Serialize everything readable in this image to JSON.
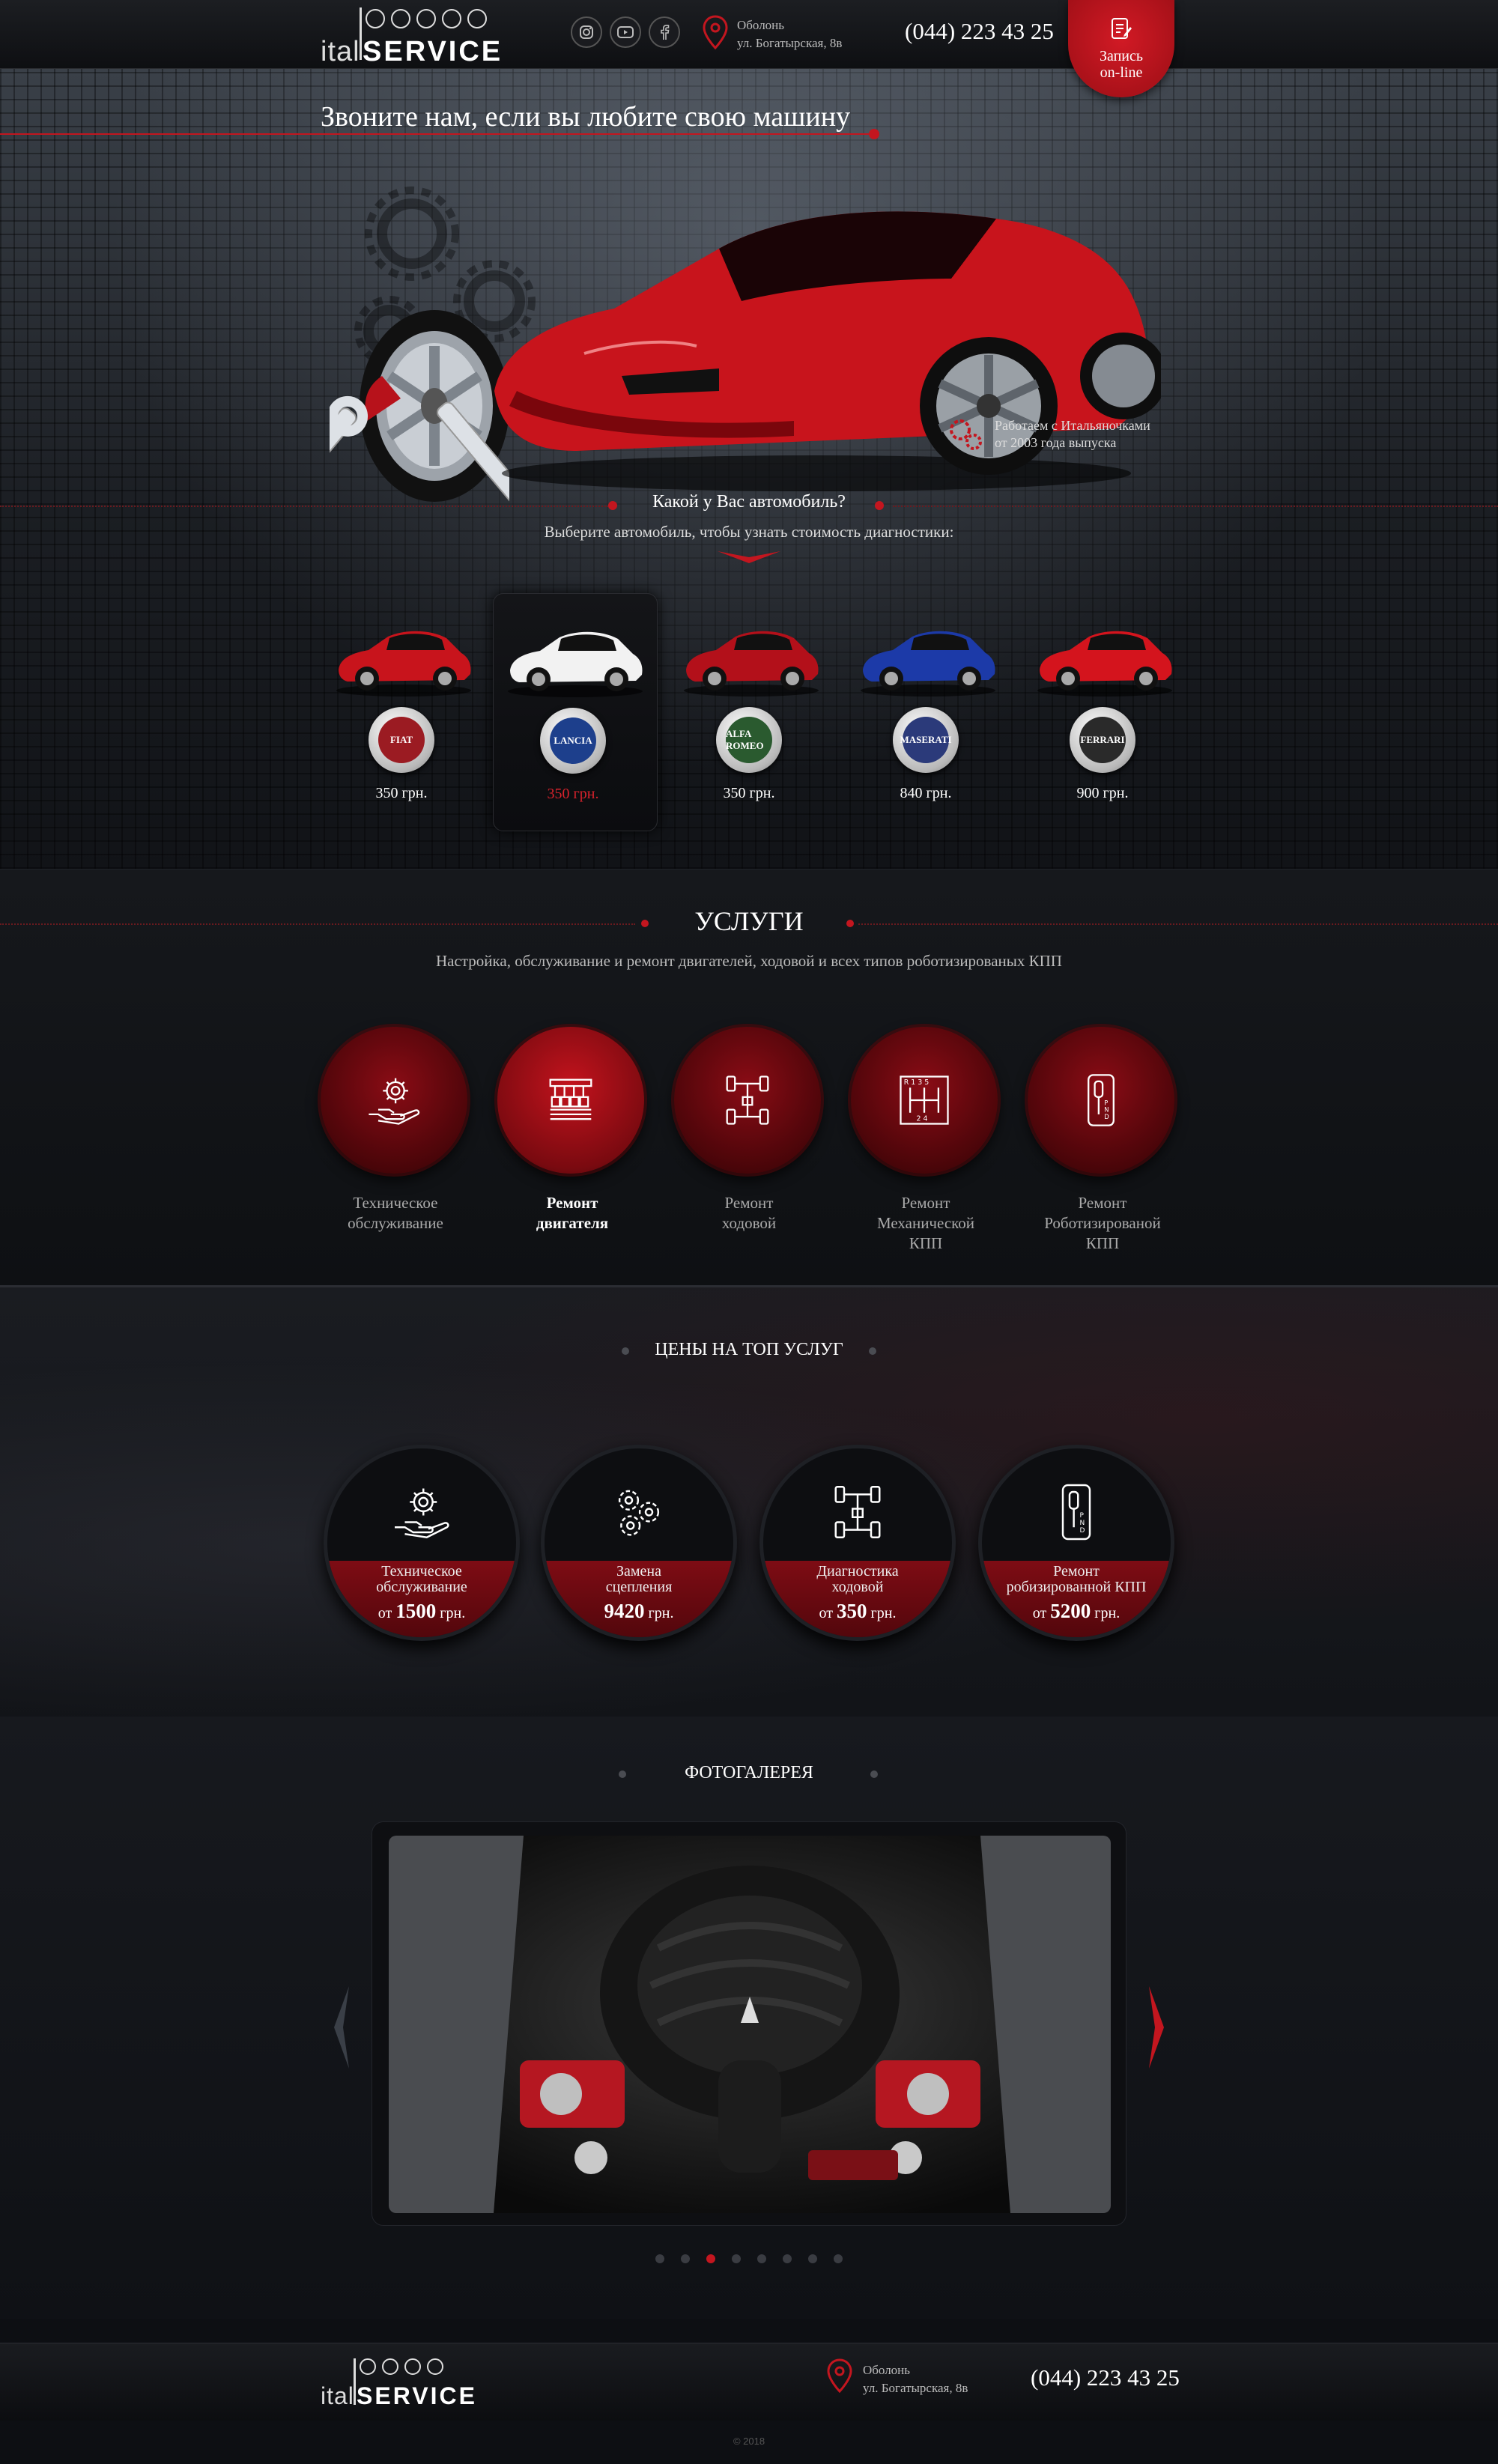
{
  "header": {
    "logo_ital": "ital",
    "logo_service": "SERVICE",
    "address_line1": "Оболонь",
    "address_line2": "ул. Богатырская, 8в",
    "phone": "(044) 223 43 25",
    "book_line1": "Запись",
    "book_line2": "on-line",
    "socials": [
      "instagram-icon",
      "youtube-icon",
      "facebook-icon"
    ]
  },
  "hero": {
    "title": "Звоните нам, если вы любите свою машину",
    "work_line1": "Работаем с Итальяночками",
    "work_line2": "от 2003 года выпуска",
    "question": "Какой у Вас автомобиль?",
    "question_sub": "Выберите автомобиль, чтобы узнать стоимость диагностики:"
  },
  "cars": [
    {
      "brand": "FIAT",
      "price": "350 грн.",
      "color": "#c8141c",
      "badge_bg": "#9b1b22",
      "active": false
    },
    {
      "brand": "LANCIA",
      "price": "350 грн.",
      "color": "#f2f2f2",
      "badge_bg": "#1d3f8c",
      "active": true
    },
    {
      "brand": "ALFA ROMEO",
      "price": "350 грн.",
      "color": "#b3101a",
      "badge_bg": "#2a5a2f",
      "active": false
    },
    {
      "brand": "MASERATI",
      "price": "840 грн.",
      "color": "#1c3aa8",
      "badge_bg": "#2b3a7a",
      "active": false
    },
    {
      "brand": "FERRARI",
      "price": "900 грн.",
      "color": "#d4141d",
      "badge_bg": "#2a2a2a",
      "active": false
    }
  ],
  "services": {
    "title": "УСЛУГИ",
    "subtitle": "Настройка, обслуживание и ремонт двигателей, ходовой и всех типов роботизированых КПП",
    "items": [
      {
        "l1": "Техническое",
        "l2": "обслуживание",
        "l3": "",
        "icon": "maintenance-icon"
      },
      {
        "l1": "Ремонт",
        "l2": "двигателя",
        "l3": "",
        "icon": "engine-icon"
      },
      {
        "l1": "Ремонт",
        "l2": "ходовой",
        "l3": "",
        "icon": "chassis-icon"
      },
      {
        "l1": "Ремонт",
        "l2": "Механической",
        "l3": "КПП",
        "icon": "manual-gearbox-icon"
      },
      {
        "l1": "Ремонт",
        "l2": "Роботизированой",
        "l3": "КПП",
        "icon": "robot-gearbox-icon"
      }
    ]
  },
  "prices": {
    "title": "ЦЕНЫ НА ТОП УСЛУГ",
    "items": [
      {
        "l1": "Техническое",
        "l2": "обслуживание",
        "from": "от",
        "amount": "1500",
        "cur": "грн.",
        "icon": "maintenance-icon"
      },
      {
        "l1": "Замена",
        "l2": "сцепления",
        "from": "",
        "amount": "9420",
        "cur": "грн.",
        "icon": "clutch-gears-icon"
      },
      {
        "l1": "Диагностика",
        "l2": "ходовой",
        "from": "от",
        "amount": "350",
        "cur": "грн.",
        "icon": "chassis-icon"
      },
      {
        "l1": "Ремонт",
        "l2": "робизированной КПП",
        "from": "от",
        "amount": "5200",
        "cur": "грн.",
        "icon": "robot-gearbox-icon"
      }
    ]
  },
  "gallery": {
    "title": "ФОТОГАЛЕРЕЯ",
    "slides_total": 8,
    "active_slide": 3
  },
  "footer": {
    "logo_ital": "ital",
    "logo_service": "SERVICE",
    "address_line1": "Оболонь",
    "address_line2": "ул. Богатырская, 8в",
    "phone": "(044) 223 43 25",
    "copyright": "© 2018"
  }
}
